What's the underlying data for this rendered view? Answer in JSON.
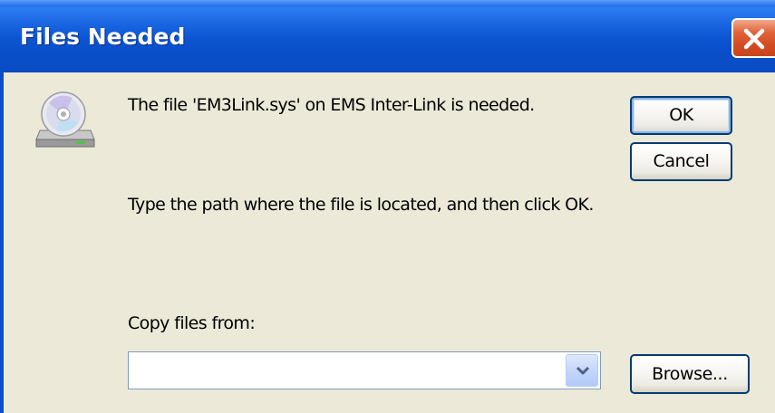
{
  "window": {
    "title": "Files Needed"
  },
  "message": {
    "file_needed": "The file 'EM3Link.sys' on EMS Inter-Link is needed.",
    "instruction": "Type the path where the file is located, and then click OK.",
    "copy_from_label": "Copy files from:"
  },
  "buttons": {
    "ok_label": "OK",
    "cancel_label": "Cancel",
    "browse_label": "Browse..."
  },
  "copy_from_field": {
    "value": ""
  },
  "icons": {
    "close": "close-icon",
    "cd_drive": "cd-drive-icon",
    "dropdown": "chevron-down-icon"
  },
  "colors": {
    "titlebar": "#0a54d2",
    "dialog_bg": "#ece9d8",
    "close_button": "#d34a22",
    "button_border": "#003c74"
  }
}
